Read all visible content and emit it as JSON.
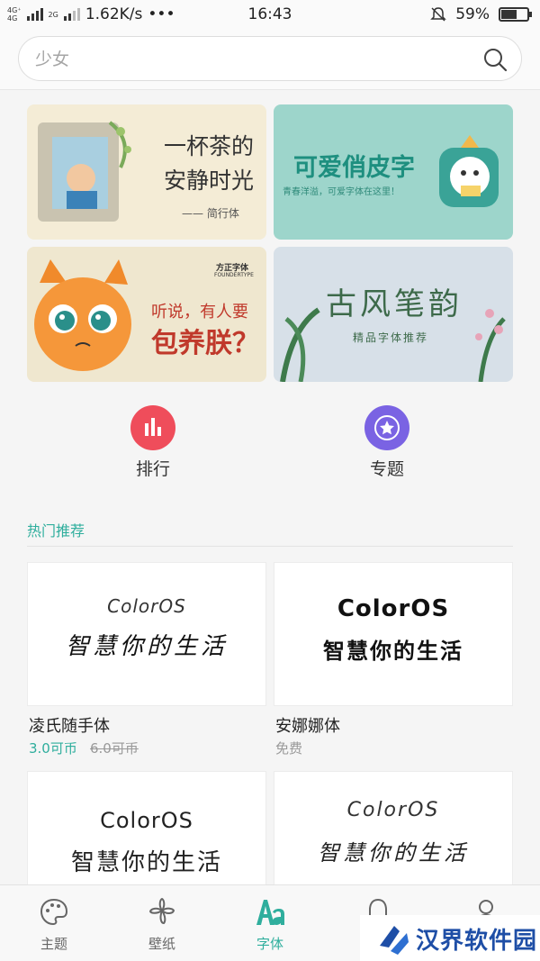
{
  "status_bar": {
    "network_1": "4G⁺",
    "network_2": "4G",
    "network_3": "2G",
    "speed": "1.62K/s",
    "more": "•••",
    "time": "16:43",
    "battery_text": "59%",
    "battery_level": 0.59
  },
  "search": {
    "placeholder": "少女"
  },
  "banners": [
    {
      "title": "一杯茶的安静时光",
      "subtitle": "—— 简行体"
    },
    {
      "title": "可爱俏皮字",
      "subtitle": "青春洋溢，可爱字体在这里！"
    },
    {
      "brand": "方正字体",
      "brand_en": "FOUNDERTYPE",
      "line1": "听说，有人要",
      "line2": "包养朕？"
    },
    {
      "title": "古风笔韵",
      "subtitle": "精品字体推荐"
    }
  ],
  "shortcuts": {
    "rank_label": "排行",
    "topic_label": "专题"
  },
  "section": {
    "title": "热门推荐"
  },
  "fonts": [
    {
      "preview_en": "ColorOS",
      "preview_cn": "智慧你的生活",
      "name": "凌氏随手体",
      "price": "3.0可币",
      "old_price": "6.0可币"
    },
    {
      "preview_en": "ColorOS",
      "preview_cn": "智慧你的生活",
      "name": "安娜娜体",
      "price": "免费"
    },
    {
      "preview_en": "ColorOS",
      "preview_cn": "智慧你的生活"
    },
    {
      "preview_en": "ColorOS",
      "preview_cn": "智慧你的生活"
    }
  ],
  "nav": {
    "items": [
      {
        "label": "主题",
        "icon": "palette-icon"
      },
      {
        "label": "壁纸",
        "icon": "flower-icon"
      },
      {
        "label": "字体",
        "icon": "font-aa-icon"
      },
      {
        "label": "",
        "icon": "bell-icon"
      },
      {
        "label": "",
        "icon": "user-icon"
      }
    ],
    "active_color": "#2fae9d"
  },
  "watermark": {
    "text": "汉界软件园"
  }
}
